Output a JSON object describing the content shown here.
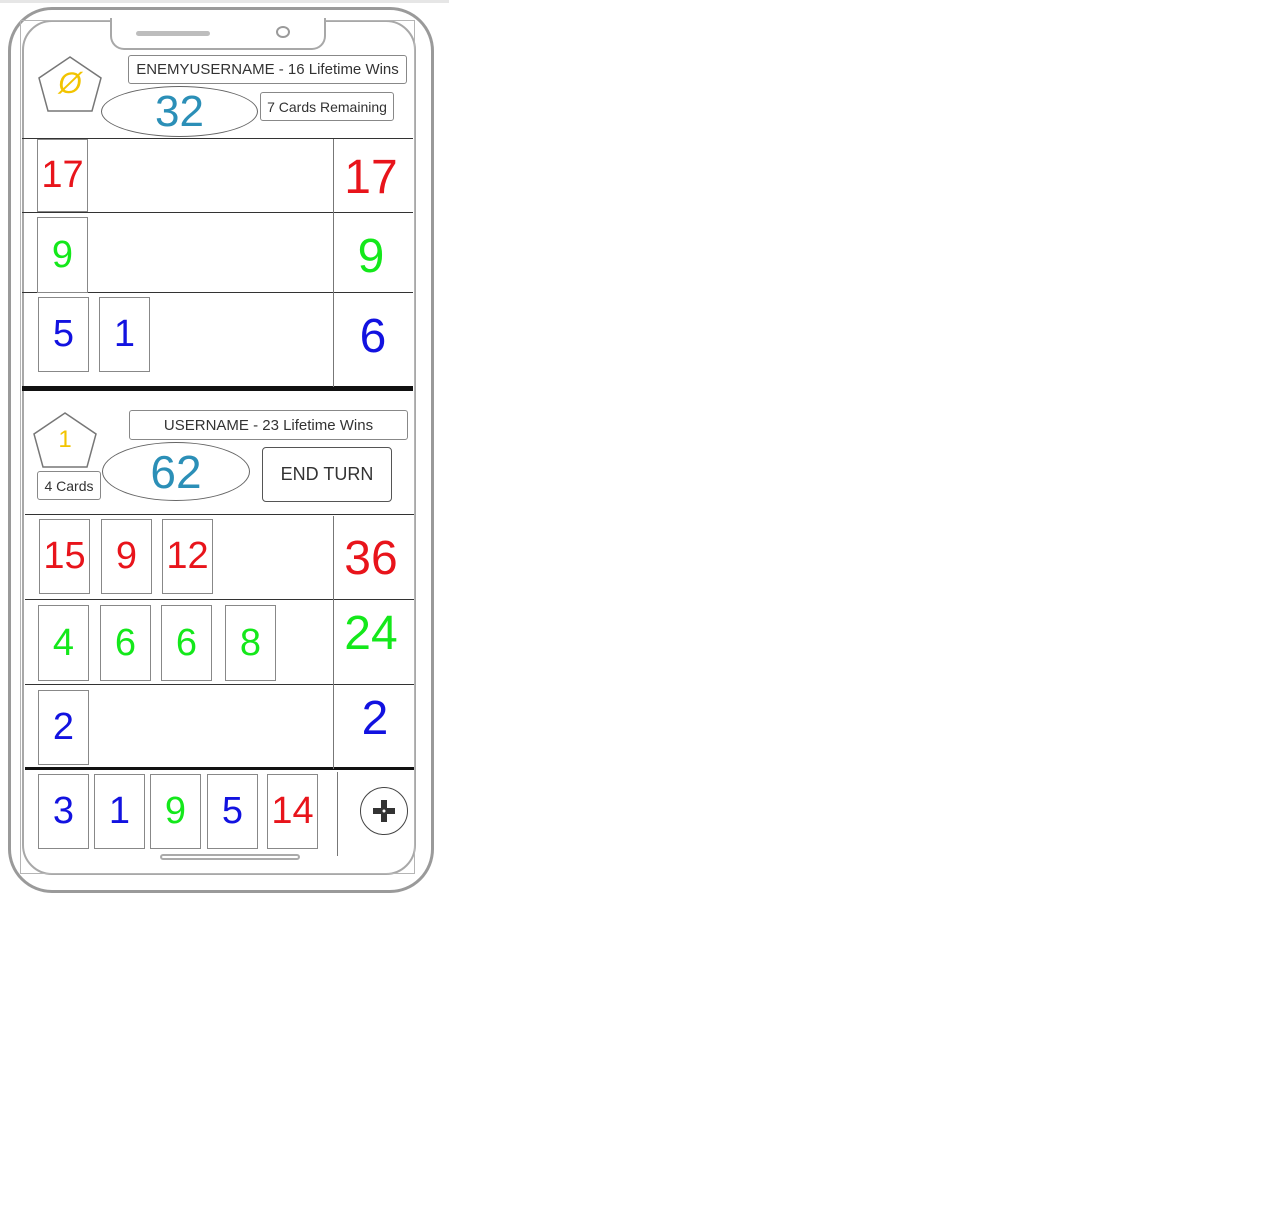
{
  "colors": {
    "red": "#e8141b",
    "green": "#14e81b",
    "blue": "#1212e0",
    "yellow": "#f2c400",
    "score": "#2b8fb7"
  },
  "enemy": {
    "name_label": "ENEMYUSERNAME - 16 Lifetime Wins",
    "icon_symbol": "Ø",
    "score": "32",
    "cards_remaining": "7 Cards Remaining",
    "rows": [
      {
        "color": "red",
        "cards": [
          "17"
        ],
        "total": "17"
      },
      {
        "color": "green",
        "cards": [
          "9"
        ],
        "total": "9"
      },
      {
        "color": "blue",
        "cards": [
          "5",
          "1"
        ],
        "total": "6"
      }
    ]
  },
  "player": {
    "name_label": "USERNAME - 23 Lifetime Wins",
    "icon_symbol": "1",
    "score": "62",
    "cards_count": "4 Cards",
    "end_turn_label": "END TURN",
    "rows": [
      {
        "color": "red",
        "cards": [
          "15",
          "9",
          "12"
        ],
        "total": "36"
      },
      {
        "color": "green",
        "cards": [
          "4",
          "6",
          "6",
          "8"
        ],
        "total": "24"
      },
      {
        "color": "blue",
        "cards": [
          "2"
        ],
        "total": "2"
      }
    ],
    "hand": [
      {
        "value": "3",
        "color": "blue"
      },
      {
        "value": "1",
        "color": "blue"
      },
      {
        "value": "9",
        "color": "green"
      },
      {
        "value": "5",
        "color": "blue"
      },
      {
        "value": "14",
        "color": "red"
      }
    ],
    "add_icon": "plus-icon"
  }
}
